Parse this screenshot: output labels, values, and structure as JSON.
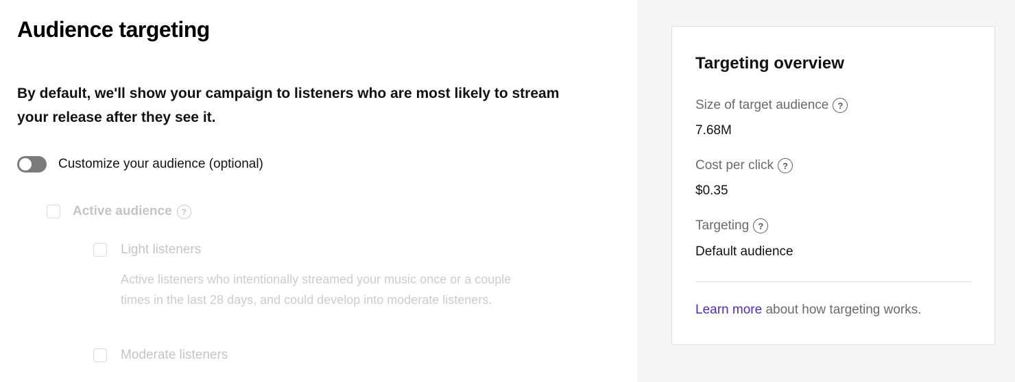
{
  "page": {
    "title": "Audience targeting",
    "intro": "By default, we'll show your campaign to listeners who are most likely to stream your release after they see it."
  },
  "customize": {
    "label": "Customize your audience (optional)",
    "enabled": false
  },
  "options": {
    "active_audience": {
      "label": "Active audience",
      "help_icon": "?",
      "checked": false,
      "disabled": true
    },
    "light_listeners": {
      "label": "Light listeners",
      "description": "Active listeners who intentionally streamed your music once or a couple times in the last 28 days, and could develop into moderate listeners.",
      "checked": false,
      "disabled": true
    },
    "moderate_listeners": {
      "label": "Moderate listeners",
      "checked": false,
      "disabled": true
    }
  },
  "overview": {
    "title": "Targeting overview",
    "help_icon": "?",
    "metrics": [
      {
        "label": "Size of target audience",
        "value": "7.68M"
      },
      {
        "label": "Cost per click",
        "value": "$0.35"
      },
      {
        "label": "Targeting",
        "value": "Default audience"
      }
    ],
    "learn_more_link": "Learn more",
    "learn_more_rest": " about how targeting works."
  },
  "colors": {
    "link": "#4b2bc0",
    "toggle_off": "#7a7a7a",
    "disabled_text": "#c4c4c4",
    "sidebar_bg": "#f5f5f5"
  }
}
